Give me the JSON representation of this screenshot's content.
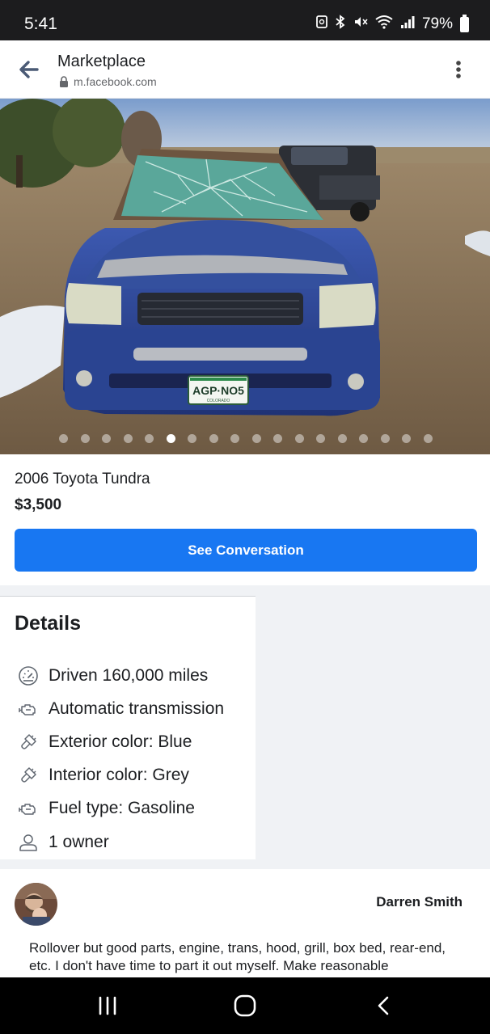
{
  "status_bar": {
    "time": "5:41",
    "battery": "79%",
    "icons": [
      "nfc-icon",
      "bluetooth-icon",
      "mute-icon",
      "wifi-icon",
      "signal-icon",
      "battery-icon"
    ]
  },
  "browser": {
    "title": "Marketplace",
    "url": "m.facebook.com"
  },
  "gallery": {
    "photo_count": 18,
    "active_index": 5,
    "license_plate": "AGP·NO5",
    "plate_state": "COLORADO"
  },
  "listing": {
    "title": "2006 Toyota Tundra",
    "price": "$3,500",
    "cta_label": "See Conversation"
  },
  "details": {
    "heading": "Details",
    "items": [
      {
        "icon": "speedometer-icon",
        "text": "Driven 160,000 miles"
      },
      {
        "icon": "engine-icon",
        "text": "Automatic transmission"
      },
      {
        "icon": "paint-brush-icon",
        "text": "Exterior color: Blue"
      },
      {
        "icon": "paint-brush-icon",
        "text": "Interior color: Grey"
      },
      {
        "icon": "engine-icon",
        "text": "Fuel type: Gasoline"
      },
      {
        "icon": "person-icon",
        "text": "1 owner"
      }
    ]
  },
  "seller": {
    "name": "Darren Smith",
    "description": "Rollover but good parts, engine, trans, hood, grill, box bed, rear-end, etc. I don't have time to part it out myself. Make reasonable"
  },
  "colors": {
    "accent": "#1877f2",
    "page_bg": "#f0f2f5",
    "text": "#1c1e21",
    "muted": "#65676b"
  }
}
